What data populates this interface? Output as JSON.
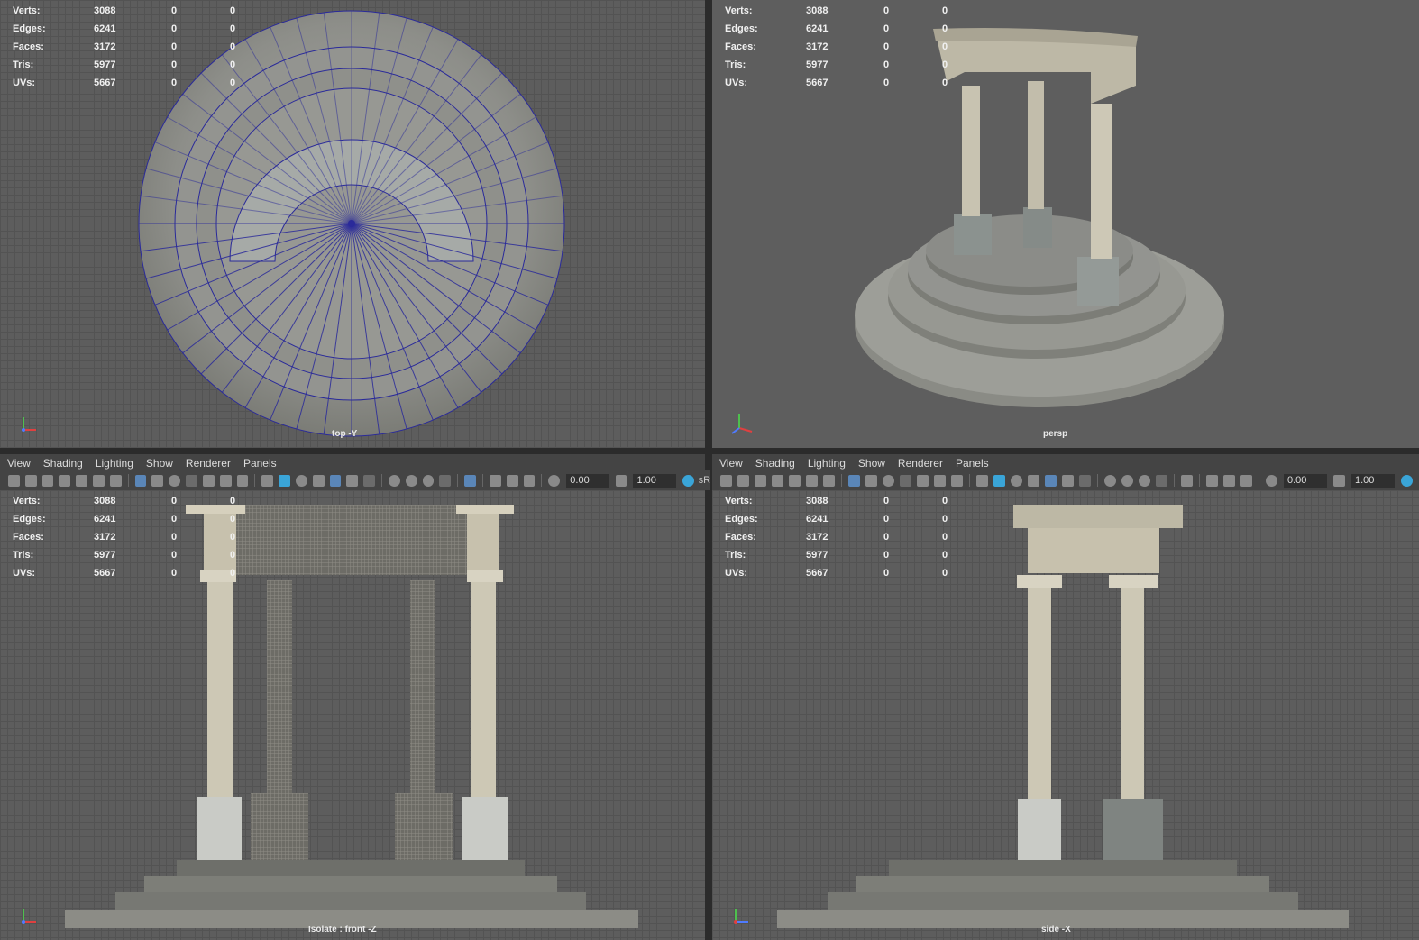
{
  "stats": [
    {
      "label": "Verts:",
      "v1": "3088",
      "v2": "0",
      "v3": "0"
    },
    {
      "label": "Edges:",
      "v1": "6241",
      "v2": "0",
      "v3": "0"
    },
    {
      "label": "Faces:",
      "v1": "3172",
      "v2": "0",
      "v3": "0"
    },
    {
      "label": "Tris:",
      "v1": "5977",
      "v2": "0",
      "v3": "0"
    },
    {
      "label": "UVs:",
      "v1": "5667",
      "v2": "0",
      "v3": "0"
    }
  ],
  "viewports": {
    "top": {
      "name": "top -Y"
    },
    "persp": {
      "name": "persp"
    },
    "front": {
      "name": "Isolate : front -Z"
    },
    "side": {
      "name": "side -X"
    }
  },
  "menu": [
    "View",
    "Shading",
    "Lighting",
    "Show",
    "Renderer",
    "Panels"
  ],
  "toolbar": {
    "field1": "0.00",
    "field2": "1.00",
    "colorspace": "sR"
  },
  "axis": {
    "x": "x",
    "y": "y",
    "z": "z"
  },
  "colors": {
    "axis_x": "#e04040",
    "axis_y": "#4ec04e",
    "axis_z": "#4f7bff",
    "wire": "#2a2a9a"
  }
}
